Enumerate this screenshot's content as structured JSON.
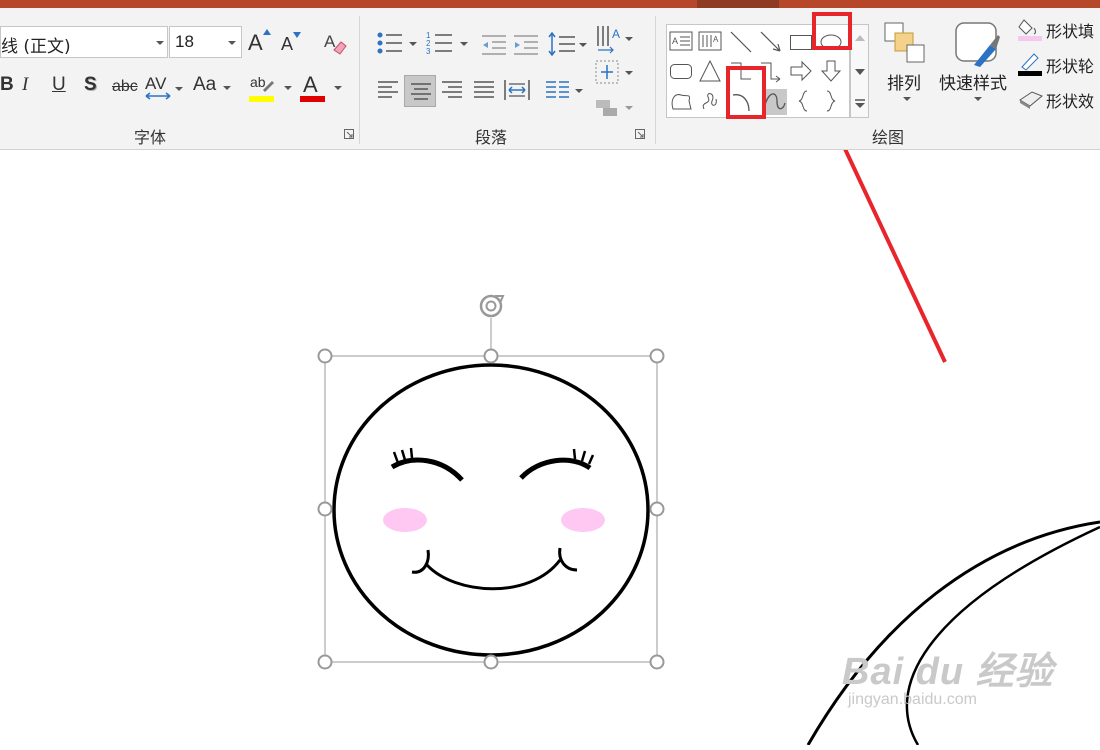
{
  "ribbon": {
    "font_group": {
      "label": "字体",
      "font_name": "线 (正文)",
      "font_size": "18",
      "grow_font_glyph": "A",
      "shrink_font_glyph": "A",
      "bold_glyph": "B",
      "italic_glyph": "I",
      "underline_glyph": "U",
      "shadow_glyph": "S",
      "strikethrough_glyph": "abc",
      "spacing_glyph": "AV",
      "case_glyph": "Aa",
      "highlight_glyph": "ab",
      "font_color_glyph": "A",
      "highlight_color": "#ffff00",
      "font_color": "#e00000"
    },
    "paragraph_group": {
      "label": "段落"
    },
    "drawing_group": {
      "label": "绘图",
      "arrange_label": "排列",
      "quick_styles_label": "快速样式",
      "shape_fill_label": "形状填",
      "shape_outline_label": "形状轮",
      "shape_effects_label": "形状效"
    }
  },
  "canvas": {
    "highlight_color": "#e8252b",
    "blush_color": "#ffc8f3"
  },
  "watermark": {
    "main": "Bai du 经验",
    "sub": "jingyan.baidu.com"
  }
}
